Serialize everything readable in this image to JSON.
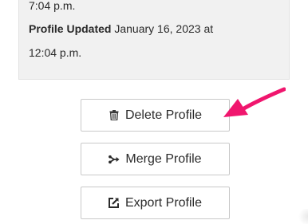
{
  "info": {
    "line1_value": "7:04 p.m.",
    "line2_label": "Profile Updated",
    "line2_value": " January 16, 2023 at",
    "line3_value": "12:04 p.m."
  },
  "actions": {
    "delete_label": "Delete Profile",
    "delete_icon": "trash-icon",
    "merge_label": "Merge Profile",
    "merge_icon": "merge-icon",
    "export_label": "Export Profile",
    "export_icon": "export-icon"
  },
  "annotation": {
    "arrow_color": "#f0166e"
  }
}
